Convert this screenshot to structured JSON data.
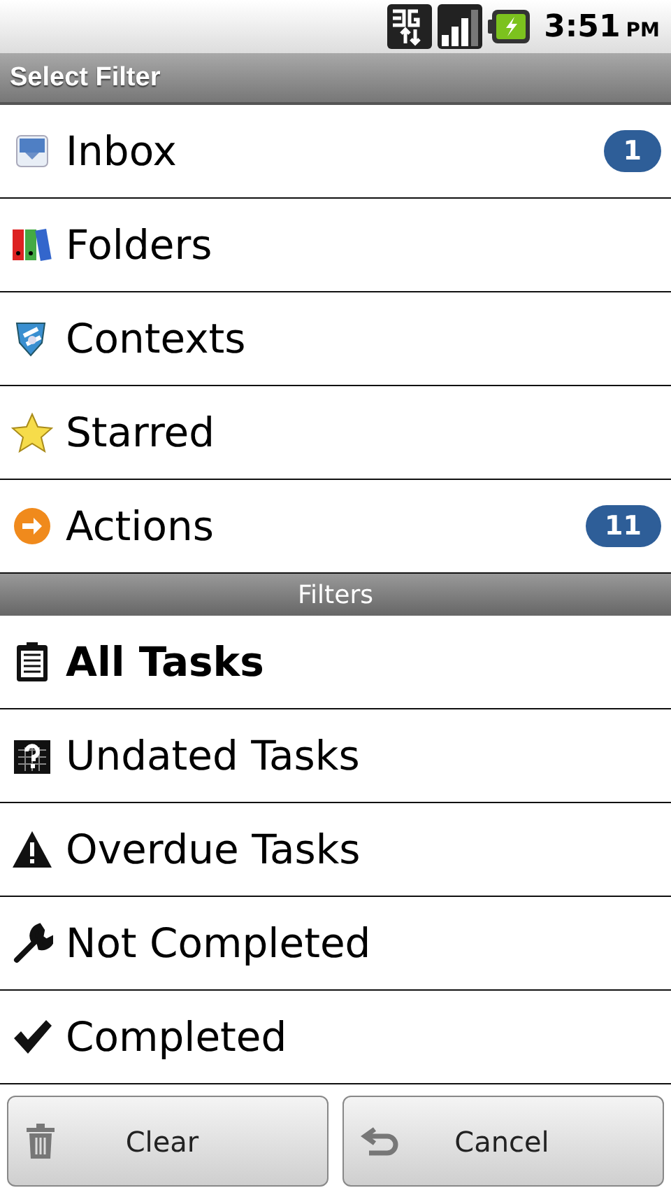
{
  "status_bar": {
    "time": "3:51",
    "meridiem": "PM"
  },
  "title": "Select Filter",
  "lists": [
    {
      "label": "Inbox",
      "count": "1",
      "selected": false
    },
    {
      "label": "Folders",
      "selected": false
    },
    {
      "label": "Contexts",
      "selected": false
    },
    {
      "label": "Starred",
      "selected": false
    },
    {
      "label": "Actions",
      "count": "11",
      "selected": false
    }
  ],
  "section_header": "Filters",
  "filters": [
    {
      "label": "All Tasks",
      "selected": true
    },
    {
      "label": "Undated Tasks",
      "selected": false
    },
    {
      "label": "Overdue Tasks",
      "selected": false
    },
    {
      "label": "Not Completed",
      "selected": false
    },
    {
      "label": "Completed",
      "selected": false
    }
  ],
  "buttons": [
    {
      "label": "Clear"
    },
    {
      "label": "Cancel"
    }
  ]
}
